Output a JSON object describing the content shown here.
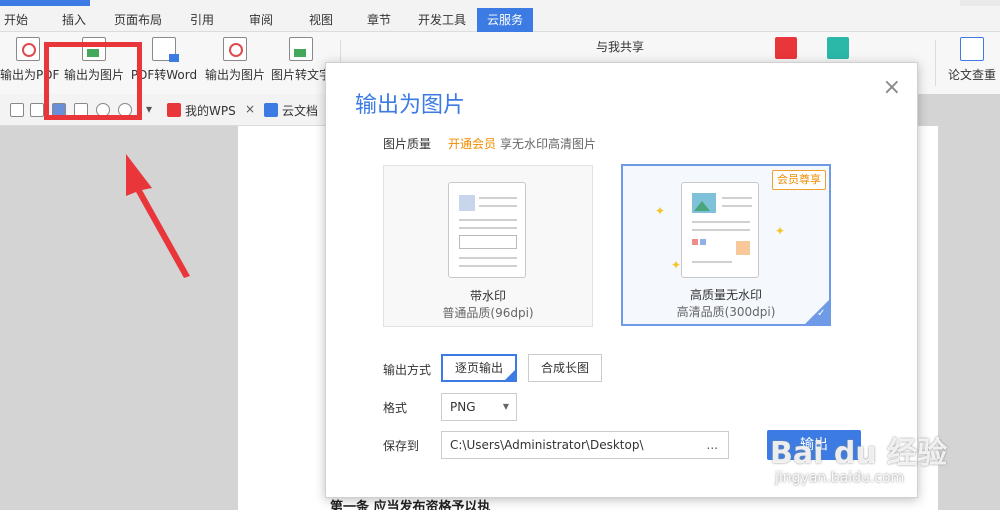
{
  "tabs": [
    "开始",
    "插入",
    "页面布局",
    "引用",
    "审阅",
    "视图",
    "章节",
    "开发工具",
    "云服务"
  ],
  "active_tab": "云服务",
  "ribbon": [
    {
      "label": "输出为PDF",
      "icon": "pdf-export-icon"
    },
    {
      "label": "输出为图片",
      "icon": "image-export-icon"
    },
    {
      "label": "PDF转Word",
      "icon": "pdf-to-word-icon"
    },
    {
      "label": "输出为图片",
      "icon": "image-export-icon"
    },
    {
      "label": "图片转文字",
      "icon": "image-to-text-icon"
    },
    {
      "label": "与我共享",
      "icon": "shared-with-me-icon"
    },
    {
      "label": "论文查重",
      "icon": "plagiarism-check-icon"
    }
  ],
  "quick_access": {
    "mywps": "我的WPS",
    "close": "×",
    "clouddoc": "云文档"
  },
  "dialog": {
    "title": "输出为图片",
    "close": "×",
    "quality_label": "图片质量",
    "vip_link": "开通会员",
    "vip_desc": "享无水印高清图片",
    "option_watermark": {
      "title": "带水印",
      "sub": "普通品质(96dpi)"
    },
    "option_hd": {
      "title": "高质量无水印",
      "sub": "高清品质(300dpi)",
      "badge": "会员尊享"
    },
    "output_mode_label": "输出方式",
    "mode_per_page": "逐页输出",
    "mode_long": "合成长图",
    "format_label": "格式",
    "format_value": "PNG",
    "save_label": "保存到",
    "save_path": "C:\\Users\\Administrator\\Desktop\\",
    "browse": "...",
    "output_button": "输出"
  },
  "doc_bottom_text": "第一条 应当发布资格予以执",
  "watermark": {
    "logo": "Bai du 经验",
    "url": "jingyan.baidu.com"
  },
  "colors": {
    "accent": "#3b7be3",
    "annotation": "#e8363a",
    "vip": "#f08c00"
  }
}
